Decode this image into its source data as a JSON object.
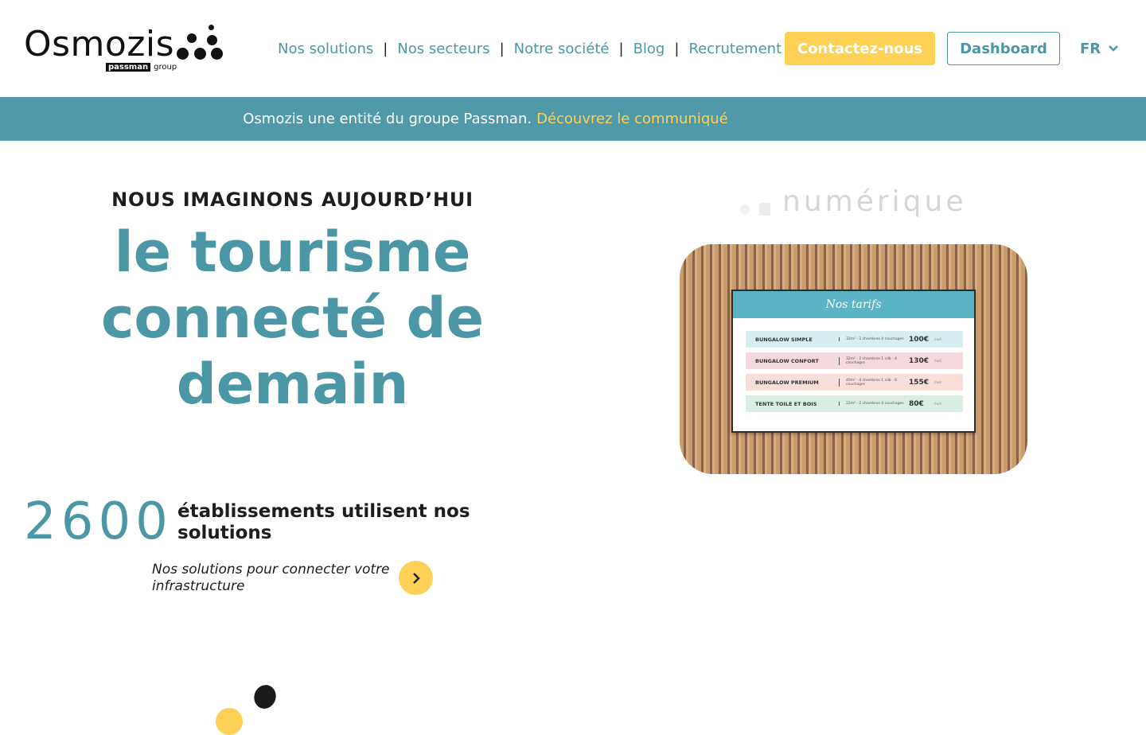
{
  "brand": {
    "name": "Osmozis",
    "sub_mark": "passman",
    "sub_text": "group"
  },
  "nav": {
    "items": [
      {
        "label": "Nos solutions"
      },
      {
        "label": "Nos secteurs"
      },
      {
        "label": "Notre société"
      },
      {
        "label": "Blog"
      },
      {
        "label": "Recrutement"
      }
    ],
    "separator": "|",
    "contact_label": "Contactez-nous",
    "dashboard_label": "Dashboard",
    "language": "FR",
    "language_icon": "chevron-down-icon"
  },
  "banner": {
    "text": "Osmozis une entité du groupe Passman.",
    "link": "Découvrez le communiqué"
  },
  "hero": {
    "kicker": "NOUS IMAGINONS AUJOURD’HUI",
    "title": "le tourisme connecté de demain",
    "rotating_word": "numérique"
  },
  "screen": {
    "heading": "Nos tarifs",
    "rows": [
      {
        "name": "BUNGALOW SIMPLE",
        "desc": "32m² - 2 chambres 4 couchages",
        "price": "100€",
        "unit": "/nuit",
        "color": "#d7eef1"
      },
      {
        "name": "BUNGALOW CONFORT",
        "desc": "32m² - 2 chambres 1 sdb - 4 couchages",
        "price": "130€",
        "unit": "/nuit",
        "color": "#f5d9df"
      },
      {
        "name": "BUNGALOW PREMIUM",
        "desc": "40m² - 4 chambres 1 sdb - 6 couchages",
        "price": "155€",
        "unit": "/nuit",
        "color": "#f8dfd8"
      },
      {
        "name": "TENTE TOILE ET BOIS",
        "desc": "22m² - 2 chambres 4 couchages",
        "price": "80€",
        "unit": "/nuit",
        "color": "#d9efe4"
      }
    ]
  },
  "stats": {
    "number": "2600",
    "text": "établissements utilisent nos solutions"
  },
  "solutions": {
    "text": "Nos solutions pour connecter votre infrastructure",
    "button_icon": "chevron-right-icon"
  },
  "colors": {
    "teal": "#4c97a5",
    "banner": "#5099a8",
    "yellow": "#fed055",
    "dark": "#1d1d1d"
  }
}
